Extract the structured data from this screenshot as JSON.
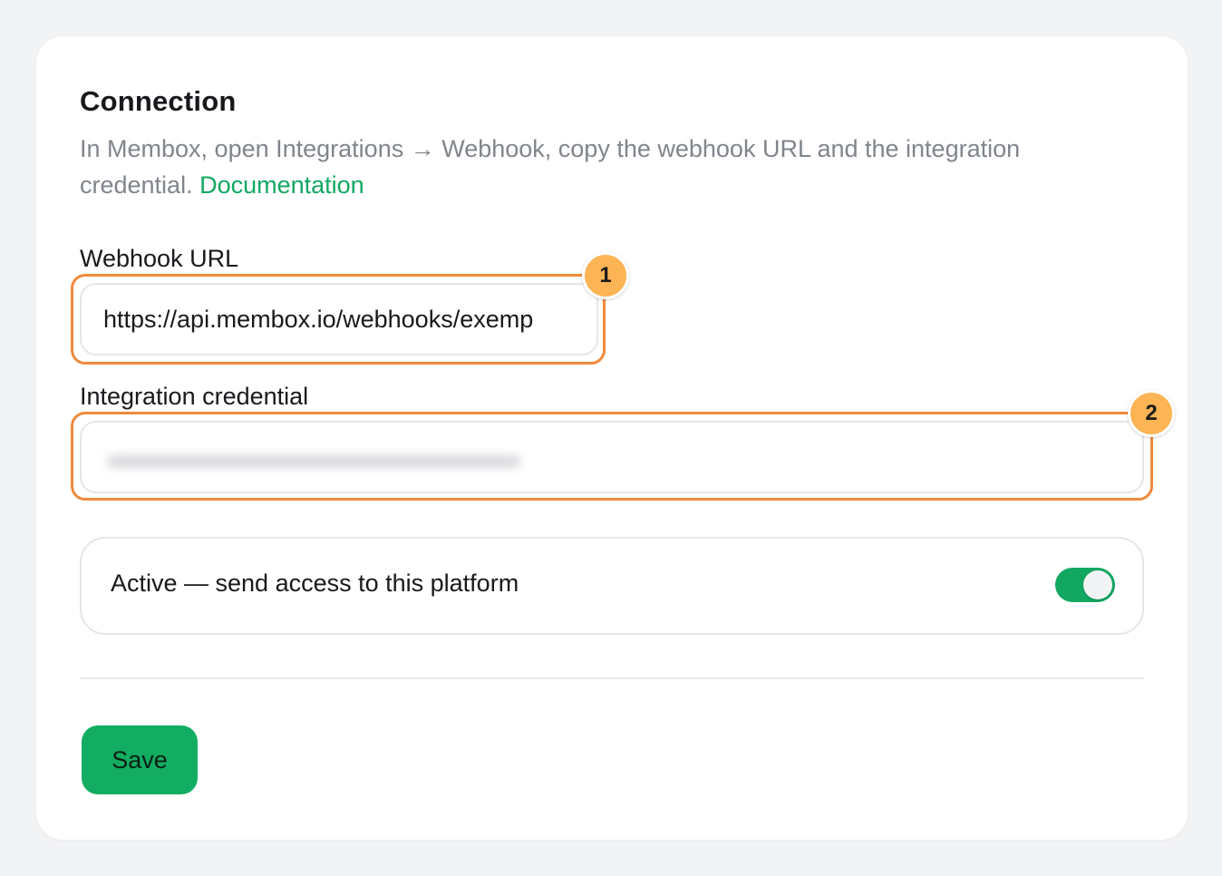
{
  "connection": {
    "title": "Connection",
    "description": "In Membox, open Integrations → Webhook, copy the webhook URL and the integration credential.",
    "doc_link": "Documentation"
  },
  "webhook_url": {
    "label": "Webhook URL",
    "value": "https://api.membox.io/webhooks/exemp"
  },
  "credential": {
    "label": "Integration credential",
    "value_state": "blurred"
  },
  "annotations": {
    "badge_1": "1",
    "badge_2": "2",
    "highlight_color": "#f08a3c",
    "badge_color": "#fcb455"
  },
  "active": {
    "label": "Active — send access to this platform",
    "enabled": true,
    "toggle_color": "#12a862"
  },
  "actions": {
    "save_label": "Save",
    "save_color": "#12ad62"
  },
  "theme": {
    "background": "#f2f3f5",
    "card": "#ffffff",
    "link_color": "#12a862"
  }
}
